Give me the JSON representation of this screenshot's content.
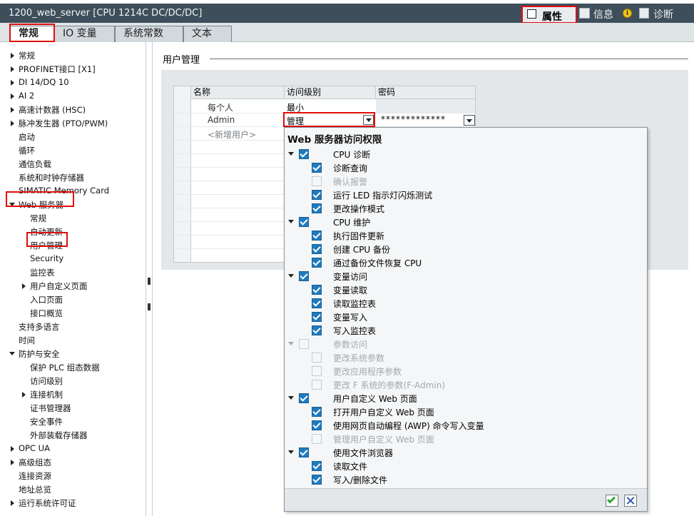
{
  "window": {
    "title": "1200_web_server [CPU 1214C DC/DC/DC]"
  },
  "toolbar": {
    "properties_label": "属性",
    "info_label": "信息",
    "diag_label": "诊断"
  },
  "tabs": [
    {
      "label": "常规"
    },
    {
      "label": "IO 变量"
    },
    {
      "label": "系统常数"
    },
    {
      "label": "文本"
    }
  ],
  "nav": {
    "items": [
      {
        "label": "常规"
      },
      {
        "label": "PROFINET接口 [X1]"
      },
      {
        "label": "DI 14/DQ 10"
      },
      {
        "label": "AI 2"
      },
      {
        "label": "高速计数器 (HSC)"
      },
      {
        "label": "脉冲发生器 (PTO/PWM)"
      },
      {
        "label": "启动"
      },
      {
        "label": "循环"
      },
      {
        "label": "通信负载"
      },
      {
        "label": "系统和时钟存储器"
      },
      {
        "label": "SIMATIC Memory Card"
      },
      {
        "label": "Web 服务器"
      },
      {
        "label": "常规"
      },
      {
        "label": "自动更新"
      },
      {
        "label": "用户管理"
      },
      {
        "label": "Security"
      },
      {
        "label": "监控表"
      },
      {
        "label": "用户自定义页面"
      },
      {
        "label": "入口页面"
      },
      {
        "label": "接口概览"
      },
      {
        "label": "支持多语言"
      },
      {
        "label": "时间"
      },
      {
        "label": "防护与安全"
      },
      {
        "label": "保护 PLC 组态数据"
      },
      {
        "label": "访问级别"
      },
      {
        "label": "连接机制"
      },
      {
        "label": "证书管理器"
      },
      {
        "label": "安全事件"
      },
      {
        "label": "外部装载存储器"
      },
      {
        "label": "OPC UA"
      },
      {
        "label": "高级组态"
      },
      {
        "label": "连接资源"
      },
      {
        "label": "地址总览"
      },
      {
        "label": "运行系统许可证"
      }
    ]
  },
  "user_mgmt": {
    "title": "用户管理",
    "columns": [
      "名称",
      "访问级别",
      "密码"
    ],
    "rows": [
      {
        "name": "每个人",
        "level": "最小",
        "password": ""
      },
      {
        "name": "Admin",
        "level": "管理",
        "password": "*************"
      },
      {
        "name": "<新增用户>",
        "level": "",
        "password": ""
      }
    ]
  },
  "permissions": {
    "title": "Web 服务器访问权限",
    "items": [
      {
        "label": "CPU 诊断",
        "checked": true,
        "enabled": true
      },
      {
        "label": "诊断查询",
        "checked": true,
        "enabled": true
      },
      {
        "label": "确认报警",
        "checked": false,
        "enabled": false
      },
      {
        "label": "运行 LED 指示灯闪烁测试",
        "checked": true,
        "enabled": true
      },
      {
        "label": "更改操作模式",
        "checked": true,
        "enabled": true
      },
      {
        "label": "CPU 维护",
        "checked": true,
        "enabled": true
      },
      {
        "label": "执行固件更新",
        "checked": true,
        "enabled": true
      },
      {
        "label": "创建 CPU 备份",
        "checked": true,
        "enabled": true
      },
      {
        "label": "通过备份文件恢复 CPU",
        "checked": true,
        "enabled": true
      },
      {
        "label": "变量访问",
        "checked": true,
        "enabled": true
      },
      {
        "label": "变量读取",
        "checked": true,
        "enabled": true
      },
      {
        "label": "读取监控表",
        "checked": true,
        "enabled": true
      },
      {
        "label": "变量写入",
        "checked": true,
        "enabled": true
      },
      {
        "label": "写入监控表",
        "checked": true,
        "enabled": true
      },
      {
        "label": "参数访问",
        "checked": false,
        "enabled": false
      },
      {
        "label": "更改系统参数",
        "checked": false,
        "enabled": false
      },
      {
        "label": "更改应用程序参数",
        "checked": false,
        "enabled": false
      },
      {
        "label": "更改 F 系统的参数(F-Admin)",
        "checked": false,
        "enabled": false
      },
      {
        "label": "用户自定义 Web 页面",
        "checked": true,
        "enabled": true
      },
      {
        "label": "打开用户自定义 Web 页面",
        "checked": true,
        "enabled": true
      },
      {
        "label": "使用网页自动编程 (AWP) 命令写入变量",
        "checked": true,
        "enabled": true
      },
      {
        "label": "管理用户自定义 Web 页面",
        "checked": false,
        "enabled": false
      },
      {
        "label": "使用文件浏览器",
        "checked": true,
        "enabled": true
      },
      {
        "label": "读取文件",
        "checked": true,
        "enabled": true
      },
      {
        "label": "写入/删除文件",
        "checked": true,
        "enabled": true
      }
    ]
  },
  "colors": {
    "highlight": "#e00d0d",
    "check": "#1f7bc0",
    "titlebar": "#3e4f5b"
  }
}
